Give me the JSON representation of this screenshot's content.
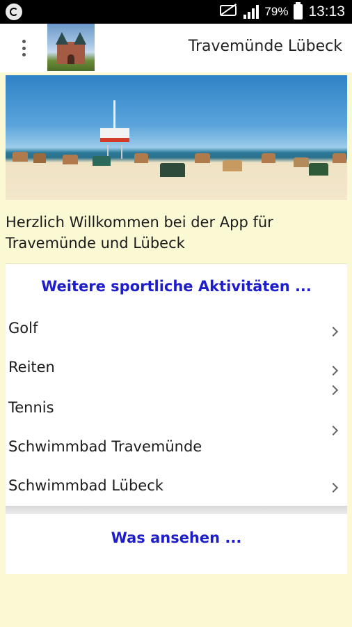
{
  "status_bar": {
    "battery_percent": "79%",
    "time": "13:13",
    "icons": [
      "sync-icon",
      "mute-icon",
      "signal-icon",
      "battery-charging-icon"
    ]
  },
  "app_bar": {
    "title": "Travemünde Lübeck",
    "menu_icon": "overflow-menu-icon",
    "logo": "holstentor-logo"
  },
  "welcome_text": "Herzlich Willkommen bei der App für Travemünde und Lübeck",
  "section_sports": {
    "header": "Weitere sportliche Aktivitäten ...",
    "items": [
      {
        "label": "Golf"
      },
      {
        "label": "Reiten"
      },
      {
        "label": "Tennis"
      },
      {
        "label": "Schwimmbad Travemünde"
      },
      {
        "label": "Schwimmbad Lübeck"
      }
    ]
  },
  "section_sights": {
    "header": "Was ansehen ..."
  },
  "colors": {
    "background": "#fbf9d3",
    "section_header": "#1d1dcc"
  }
}
